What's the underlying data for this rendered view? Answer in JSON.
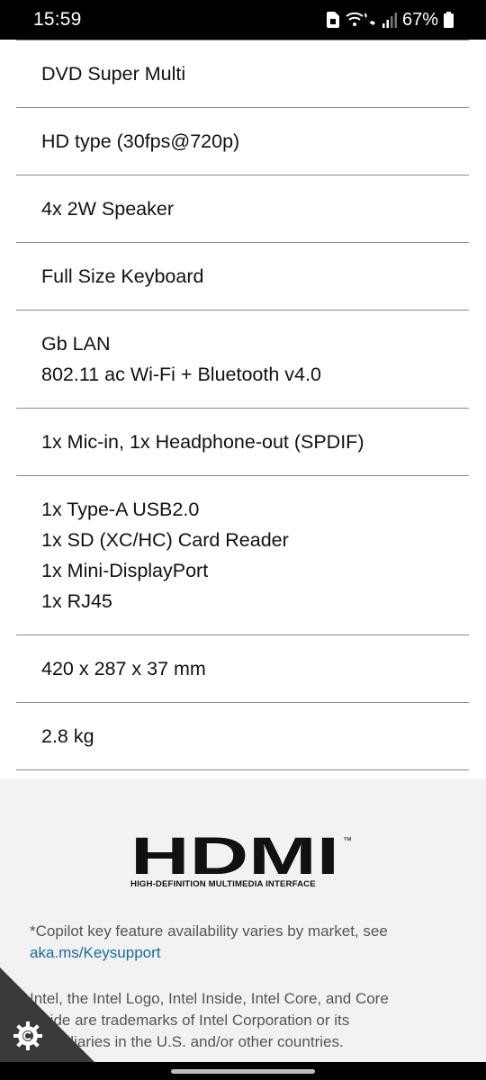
{
  "status_bar": {
    "time": "15:59",
    "battery_percent": "67%",
    "icons": [
      "sim-card-icon",
      "wifi-calling-icon",
      "signal-icon",
      "battery-icon"
    ]
  },
  "specs": {
    "rows": [
      {
        "lines": [
          "DVD Super Multi"
        ]
      },
      {
        "lines": [
          "HD type (30fps@720p)"
        ]
      },
      {
        "lines": [
          "4x 2W Speaker"
        ]
      },
      {
        "lines": [
          "Full Size Keyboard"
        ]
      },
      {
        "lines": [
          "Gb LAN",
          "802.11 ac Wi-Fi + Bluetooth v4.0"
        ]
      },
      {
        "lines": [
          "1x Mic-in, 1x Headphone-out (SPDIF)"
        ]
      },
      {
        "lines": [
          "1x Type-A USB2.0",
          "1x SD (XC/HC) Card Reader",
          "1x Mini-DisplayPort",
          "1x RJ45"
        ]
      },
      {
        "lines": [
          "420 x 287 x 37 mm"
        ]
      },
      {
        "lines": [
          "2.8 kg"
        ]
      }
    ]
  },
  "footer": {
    "hdmi_logo_text": "HDMI",
    "hdmi_trademark": "™",
    "hdmi_tagline": "HIGH-DEFINITION MULTIMEDIA INTERFACE",
    "copilot_note": "*Copilot key feature availability varies by market, see",
    "copilot_link": "aka.ms/Keysupport",
    "legal_lines": [
      "Intel, the Intel Logo, Intel Inside, Intel Core, and Core",
      "Inside are trademarks of Intel Corporation or its",
      "subsidiaries in the U.S. and/or other countries."
    ]
  },
  "colors": {
    "link": "#1a6aa6",
    "footer_bg": "#f2f2f2",
    "divider": "#8a8a8a",
    "cookie_corner": "#3a3a3a"
  }
}
